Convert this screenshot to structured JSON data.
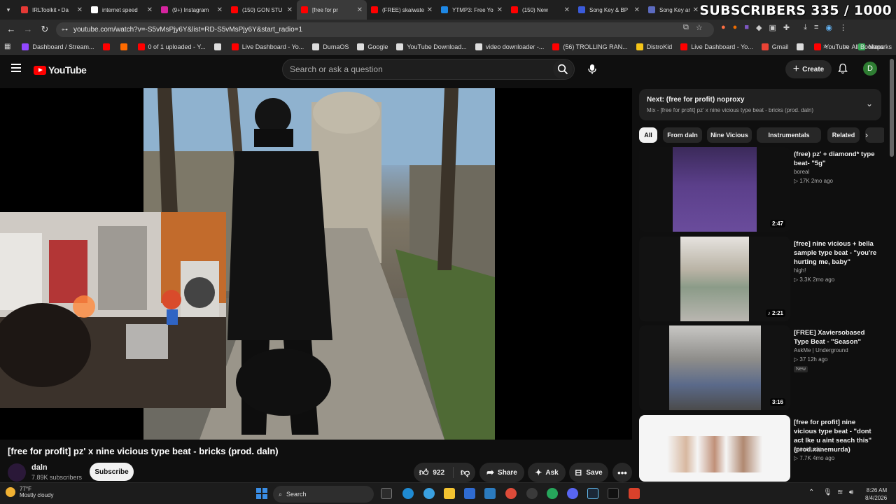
{
  "stream_overlay": {
    "subscriber_goal": "SUBSCRIBERS 335 / 1000"
  },
  "browser": {
    "tabs": [
      {
        "label": "IRLToolkit • Da",
        "color": "#e53935"
      },
      {
        "label": "internet speed",
        "color": "#ffffff"
      },
      {
        "label": "(9+) Instagram",
        "color": "#d6249f"
      },
      {
        "label": "(150) GON STU",
        "color": "#ff0000"
      },
      {
        "label": "[free for pr",
        "color": "#ff0000"
      },
      {
        "label": "(FREE) skaiwate",
        "color": "#ff0000"
      },
      {
        "label": "YTMP3: Free Yo",
        "color": "#1e88e5"
      },
      {
        "label": "(150) New",
        "color": "#ff0000"
      },
      {
        "label": "Song Key & BP",
        "color": "#3b5bdb"
      },
      {
        "label": "Song Key and",
        "color": "#5c6bc0"
      }
    ],
    "url": "youtube.com/watch?v=-S5vMsPjy6Y&list=RD-S5vMsPjy6Y&start_radio=1",
    "bookmarks": [
      {
        "label": "Dashboard / Stream...",
        "color": "#9147ff"
      },
      {
        "label": "",
        "color": "#ff0000"
      },
      {
        "label": "",
        "color": "#ff6b00"
      },
      {
        "label": "0 of 1 uploaded - Y...",
        "color": "#ff0000"
      },
      {
        "label": "",
        "color": "#dddddd"
      },
      {
        "label": "Live Dashboard - Yo...",
        "color": "#ff0000"
      },
      {
        "label": "DumaOS",
        "color": "#dddddd"
      },
      {
        "label": "Google",
        "color": "#dddddd"
      },
      {
        "label": "YouTube Download...",
        "color": "#dddddd"
      },
      {
        "label": "video downloader -...",
        "color": "#dddddd"
      },
      {
        "label": "(56) TROLLING RAN...",
        "color": "#ff0000"
      },
      {
        "label": "DistroKid",
        "color": "#f5c518"
      },
      {
        "label": "Live Dashboard - Yo...",
        "color": "#ff0000"
      },
      {
        "label": "Gmail",
        "color": "#ea4335"
      },
      {
        "label": "",
        "color": "#dddddd"
      },
      {
        "label": "YouTube",
        "color": "#ff0000"
      },
      {
        "label": "Maps",
        "color": "#34a853"
      }
    ],
    "all_bookmarks": "All Bookmarks"
  },
  "youtube": {
    "logo_text": "YouTube",
    "search_placeholder": "Search or ask a question",
    "create_label": "Create",
    "avatar_letter": "D",
    "video": {
      "title": "[free for profit] pz' x nine vicious type beat - bricks (prod. daln)",
      "channel": "daln",
      "subscribers": "7.89K subscribers",
      "subscribe_label": "Subscribe",
      "likes": "922",
      "share_label": "Share",
      "ask_label": "Ask",
      "save_label": "Save"
    },
    "next": {
      "title": "Next: (free for profit) noproxy",
      "subtitle": "Mix - [free for profit] pz' x nine vicious type beat - bricks (prod. daln)"
    },
    "chips": [
      "All",
      "From daln",
      "Nine Vicious",
      "Instrumentals",
      "Related"
    ],
    "recommendations": [
      {
        "title": "(free) pz' + diamond* type beat- \"5g\"",
        "channel": "boreal",
        "meta": "▷ 17K   2mo ago",
        "duration": "2:47",
        "badge": ""
      },
      {
        "title": "[free] nine vicious + bella sample type beat - \"you're hurting me, baby\"",
        "channel": "high!",
        "meta": "▷ 3.3K   2mo ago",
        "duration": "♪ 2:21",
        "badge": ""
      },
      {
        "title": "[FREE] Xaviersobased Type Beat - \"Season\"",
        "channel": "AskMe | Underground",
        "meta": "▷ 37   12h ago",
        "duration": "3:16",
        "badge": "New"
      },
      {
        "title": "[free for profit] nine vicious type beat - \"dont act lke u aint seach this\" (prod.xanemurda)",
        "channel": "xanemurda",
        "meta": "▷ 7.7K   4mo ago",
        "duration": "",
        "badge": ""
      }
    ]
  },
  "taskbar": {
    "weather_temp": "77°F",
    "weather_desc": "Mostly cloudy",
    "search_label": "Search",
    "time": "8:26 AM",
    "date": "8/4/2026"
  }
}
